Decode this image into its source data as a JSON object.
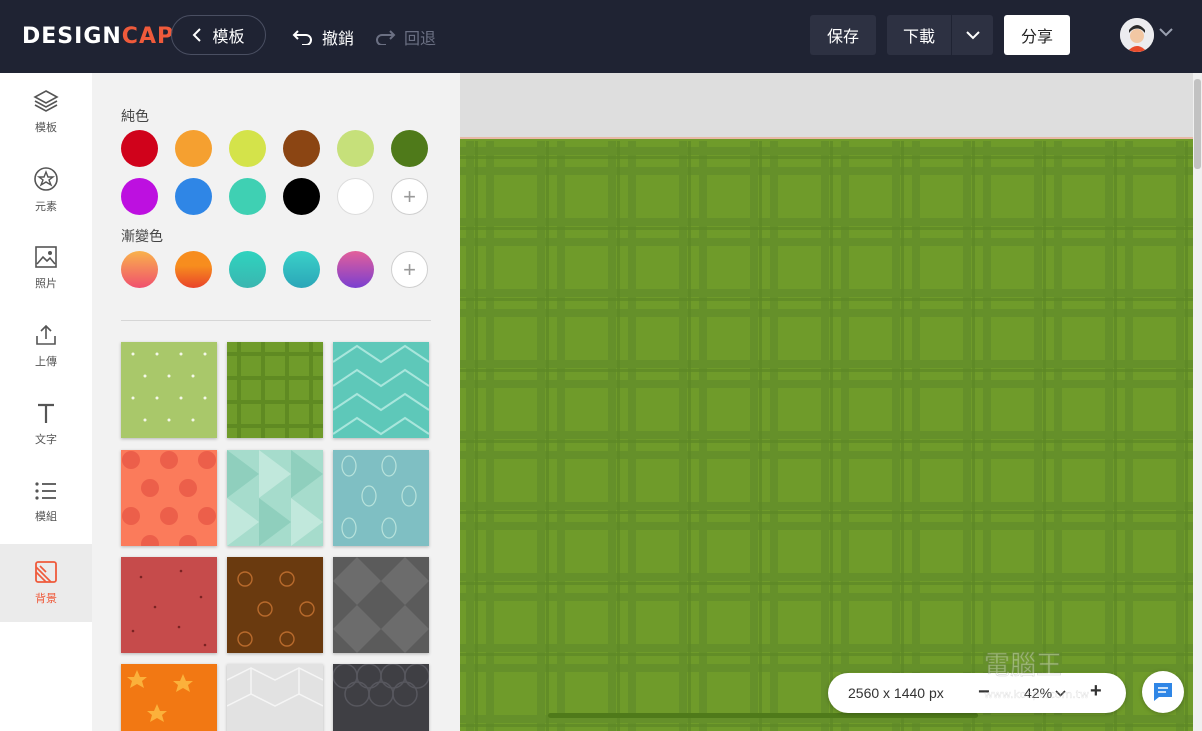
{
  "header": {
    "logo_main": "DESIGN",
    "logo_accent": "CAP",
    "back_label": "模板",
    "undo_label": "撤銷",
    "redo_label": "回退",
    "save_label": "保存",
    "download_label": "下載",
    "share_label": "分享"
  },
  "rail": {
    "items": [
      {
        "label": "模板",
        "icon": "layers-icon"
      },
      {
        "label": "元素",
        "icon": "shapes-icon"
      },
      {
        "label": "照片",
        "icon": "image-icon"
      },
      {
        "label": "上傳",
        "icon": "upload-icon"
      },
      {
        "label": "文字",
        "icon": "text-icon"
      },
      {
        "label": "模組",
        "icon": "list-icon"
      },
      {
        "label": "背景",
        "icon": "background-icon",
        "active": true
      }
    ]
  },
  "panel": {
    "solid_title": "純色",
    "gradient_title": "漸變色",
    "solid_colors": [
      "#d0021b",
      "#f5a030",
      "#d4e34a",
      "#8b4513",
      "#c6e07a",
      "#4f7a1a",
      "#bd10e0",
      "#2f86e6",
      "#3fd0b3",
      "#000000",
      "#ffffff"
    ],
    "gradients": [
      [
        "#f9b24b",
        "#f0506e"
      ],
      [
        "#f78d1e",
        "#e9432a"
      ],
      [
        "#2fd3bf",
        "#3ab6b0"
      ],
      [
        "#3ad1c8",
        "#2ba6b8"
      ],
      [
        "#e35f9a",
        "#7a3fd0"
      ]
    ],
    "add_symbol": "+"
  },
  "canvas": {
    "size_label": "2560 x 1440 px",
    "zoom_label": "42%",
    "zoom_minus": "−",
    "zoom_plus": "+"
  },
  "accent_color": "#ef5a3b",
  "watermark_text": "www.kocpc.com.tw"
}
